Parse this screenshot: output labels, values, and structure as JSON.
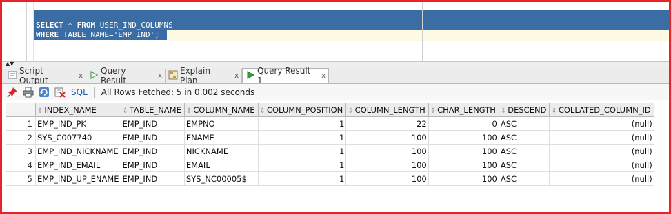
{
  "editor": {
    "line1_kw1": "SELECT",
    "line1_rest": " * ",
    "line1_kw2": "FROM",
    "line1_tail": " USER_IND_COLUMNS",
    "line2_kw": "WHERE",
    "line2_tail": " TABLE_NAME='EMP_IND';"
  },
  "tabs": [
    {
      "label": "Script Output",
      "close": "x",
      "icon": "script-output-icon"
    },
    {
      "label": "Query Result",
      "close": "x",
      "icon": "play-icon"
    },
    {
      "label": "Explain Plan",
      "close": "x",
      "icon": "explain-plan-icon"
    },
    {
      "label": "Query Result 1",
      "close": "x",
      "icon": "play-icon"
    }
  ],
  "toolbar": {
    "sql_label": "SQL",
    "status": "All Rows Fetched: 5 in 0.002 seconds"
  },
  "grid": {
    "columns": [
      "INDEX_NAME",
      "TABLE_NAME",
      "COLUMN_NAME",
      "COLUMN_POSITION",
      "COLUMN_LENGTH",
      "CHAR_LENGTH",
      "DESCEND",
      "COLLATED_COLUMN_ID"
    ],
    "rows": [
      [
        "1",
        "EMP_IND_PK",
        "EMP_IND",
        "EMPNO",
        "1",
        "22",
        "0",
        "ASC",
        "(null)"
      ],
      [
        "2",
        "SYS_C007740",
        "EMP_IND",
        "ENAME",
        "1",
        "100",
        "100",
        "ASC",
        "(null)"
      ],
      [
        "3",
        "EMP_IND_NICKNAME",
        "EMP_IND",
        "NICKNAME",
        "1",
        "100",
        "100",
        "ASC",
        "(null)"
      ],
      [
        "4",
        "EMP_IND_EMAIL",
        "EMP_IND",
        "EMAIL",
        "1",
        "100",
        "100",
        "ASC",
        "(null)"
      ],
      [
        "5",
        "EMP_IND_UP_ENAME",
        "EMP_IND",
        "SYS_NC00005$",
        "1",
        "100",
        "100",
        "ASC",
        "(null)"
      ]
    ]
  },
  "colors": {
    "frame": "#e8232a",
    "selection": "#3b6da5",
    "sql_link": "#1d5fa8"
  }
}
